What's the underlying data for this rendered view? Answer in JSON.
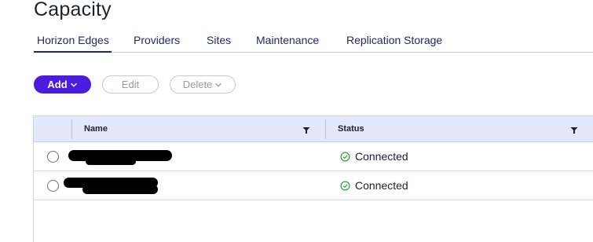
{
  "page": {
    "title": "Capacity"
  },
  "tabs": [
    {
      "label": "Horizon Edges",
      "active": true
    },
    {
      "label": "Providers",
      "active": false
    },
    {
      "label": "Sites",
      "active": false
    },
    {
      "label": "Maintenance",
      "active": false
    },
    {
      "label": "Replication Storage",
      "active": false
    }
  ],
  "toolbar": {
    "add_label": "Add",
    "edit_label": "Edit",
    "delete_label": "Delete"
  },
  "grid": {
    "columns": [
      {
        "label": "Name",
        "icon": "filter-icon"
      },
      {
        "label": "Status",
        "icon": "filter-icon"
      }
    ],
    "rows": [
      {
        "name": "",
        "status": "Connected",
        "status_icon": "check-circle-icon"
      },
      {
        "name": "",
        "status": "Connected",
        "status_icon": "check-circle-icon"
      }
    ]
  },
  "colors": {
    "accent": "#4b1be0",
    "header_bg": "#e3e8fb",
    "success": "#2e9e3e",
    "tab_text": "#1f2a6b"
  }
}
